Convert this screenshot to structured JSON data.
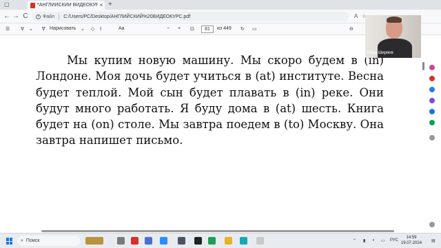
{
  "browser": {
    "tab_title": "*АНГЛИЙСКИЙ ВИДЕОКУРС.pdf",
    "tab_close": "×",
    "new_tab": "+",
    "back": "←",
    "forward": "→",
    "reload": "C",
    "address_label": "Файл",
    "address": "C:/Users/PC/Desktop/АНГЛИЙСКИЙ%20ВИДЕОКУРС.pdf"
  },
  "pdf_toolbar": {
    "draw_label": "Нарисовать",
    "zoom_out": "−",
    "zoom_in": "+",
    "page_current": "81",
    "page_total": "из 449"
  },
  "document": {
    "text": "Мы купим новую машину.    Мы скоро будем в (in) Лондоне.    Моя дочь будет учиться в (at) институте.    Весна будет теплой.    Мой сын будет плавать в (in) реке.    Они будут много работать.    Я буду дома в (at) шесть.    Книга будет на (on) столе.    Мы завтра поедем в (to) Москву.    Она завтра напишет письмо."
  },
  "webcam": {
    "name": "Иван Ширяев"
  },
  "taskbar": {
    "search_placeholder": "Поиск",
    "language": "РУС",
    "time": "14:59",
    "date": "19.07.2024"
  },
  "colors": {
    "pdf_icon": "#d93025",
    "windows_accent": "#1a73e8",
    "taskbar_bg": "#e8ecf0"
  }
}
